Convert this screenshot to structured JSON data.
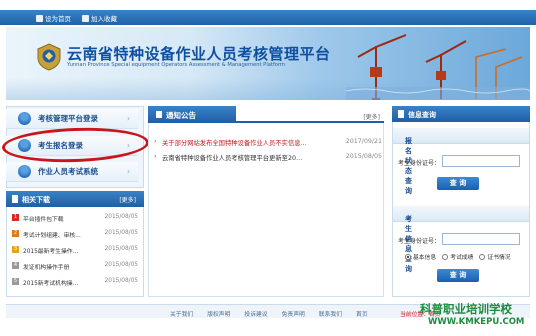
{
  "topbar": {
    "home_label": "设为首页",
    "fav_label": "加入收藏"
  },
  "banner": {
    "title": "云南省特种设备作业人员考核管理平台",
    "subtitle": "Yunnan Province Special equipment Operators Assessment & Management Platform"
  },
  "left_nav": {
    "items": [
      {
        "label": "考核管理平台登录",
        "arrow": "›"
      },
      {
        "label": "考生报名登录",
        "arrow": "›"
      },
      {
        "label": "作业人员考试系统",
        "arrow": "›"
      }
    ]
  },
  "downloads": {
    "title": "相关下载",
    "more": "[更多]",
    "items": [
      {
        "num": "1",
        "color": "#d9281f",
        "text": "平台插件包下载",
        "date": "2015/08/05"
      },
      {
        "num": "2",
        "color": "#e07a1c",
        "text": "考试计划组建、审核…",
        "date": "2015/08/05"
      },
      {
        "num": "3",
        "color": "#e8a21a",
        "text": "2015最新考生操作…",
        "date": "2015/08/05"
      },
      {
        "num": "4",
        "color": "#9a9a9a",
        "text": "发证机构操作手册",
        "date": "2015/08/05"
      },
      {
        "num": "5",
        "color": "#9a9a9a",
        "text": "2015新考试机构操…",
        "date": "2015/08/05"
      }
    ]
  },
  "news": {
    "title": "通知公告",
    "more": "[更多]",
    "items": [
      {
        "text": "关于部分网站发布全国特种设备作业人员不实信息…",
        "date": "2017/09/21"
      },
      {
        "text": "云南省特种设备作业人员考核管理平台更新至20…",
        "date": "2015/08/05"
      }
    ]
  },
  "info": {
    "title": "信息查询",
    "status_section": {
      "title": "报名状态查询",
      "chevron": "⌄",
      "field_label": "考生身份证号：",
      "field_value": "",
      "button": "查 询"
    },
    "info_section": {
      "title": "考生信息查询",
      "chevron": "⌄",
      "field_label": "考生身份证号：",
      "field_value": "",
      "options": [
        "基本信息",
        "考试成绩",
        "证书情况"
      ],
      "selected": 0,
      "button": "查 询"
    }
  },
  "footer": {
    "links": [
      "关于我们",
      "版权声明",
      "投诉建议",
      "免责声明",
      "联系我们",
      "首页"
    ],
    "current": "当前位置：首页"
  },
  "watermark": {
    "line1": "科普职业培训学校",
    "line2": "WWW.KMKEPU.COM"
  }
}
